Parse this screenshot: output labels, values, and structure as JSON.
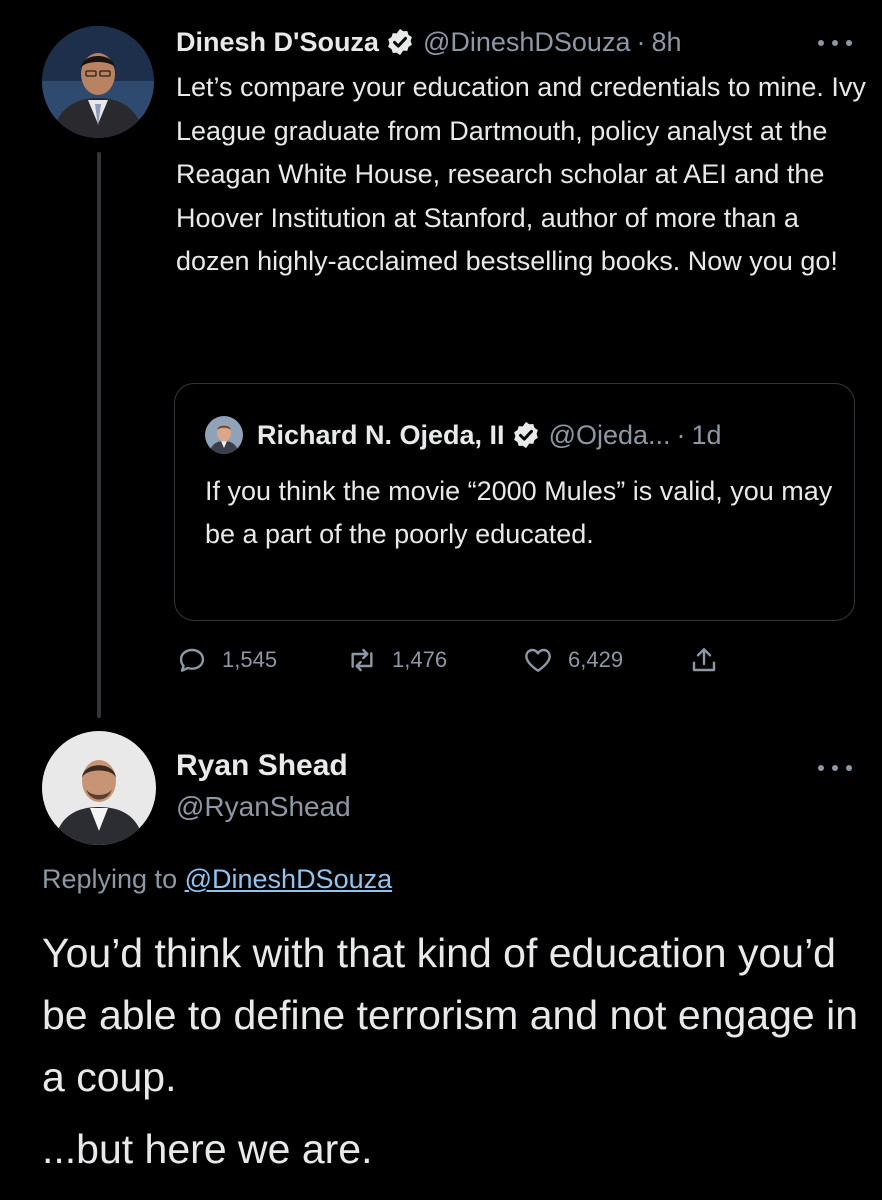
{
  "tweet1": {
    "author_name": "Dinesh D'Souza",
    "author_handle": "@DineshDSouza",
    "time": "8h",
    "text": "Let’s compare your education and credentials  to mine. Ivy League graduate from Dartmouth, policy analyst at the Reagan White House, research scholar at AEI and the Hoover Institution at Stanford, author of more than a dozen highly-acclaimed bestselling books. Now you go!",
    "quoted": {
      "author_name": "Richard N. Ojeda, II",
      "author_handle": "@Ojeda...",
      "time": "1d",
      "text": "If you think the movie “2000 Mules” is valid, you may be a part of the poorly educated."
    },
    "stats": {
      "replies": "1,545",
      "retweets": "1,476",
      "likes": "6,429"
    }
  },
  "tweet2": {
    "author_name": "Ryan Shead",
    "author_handle": "@RyanShead",
    "replying_prefix": "Replying to",
    "replying_handle": "@DineshDSouza",
    "text": "You’d think with that kind of education you’d be able to define terrorism and not engage in a coup.",
    "text2": "...but here we are."
  },
  "icons": {
    "verified": "verified-badge-icon",
    "more": "more-icon",
    "reply": "reply-icon",
    "retweet": "retweet-icon",
    "like": "heart-icon",
    "share": "share-icon"
  },
  "colors": {
    "background": "#000000",
    "text": "#e7e9ea",
    "secondary": "#8b98a5",
    "link": "#8fc4f0",
    "border": "#333639"
  }
}
